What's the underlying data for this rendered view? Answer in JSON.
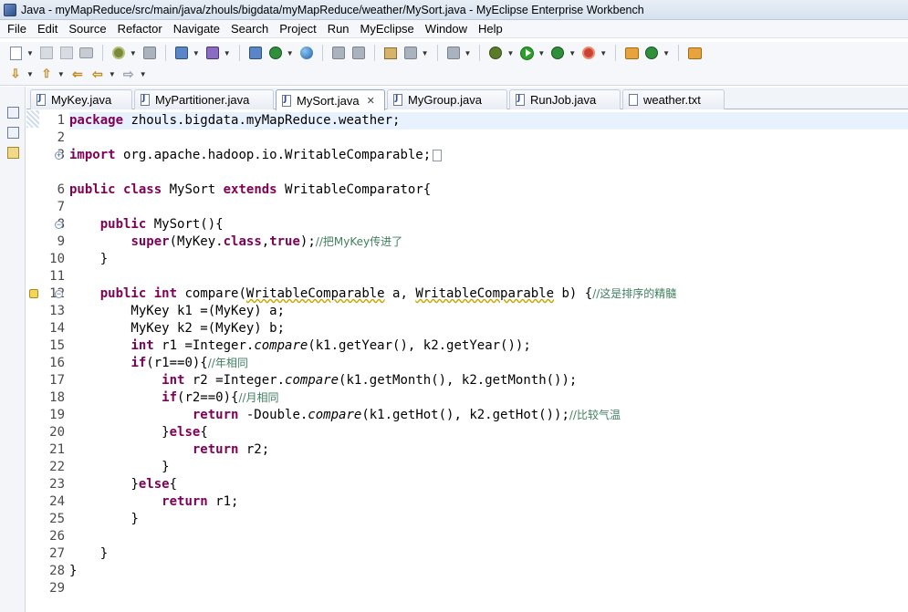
{
  "window": {
    "title": "Java - myMapReduce/src/main/java/zhouls/bigdata/myMapReduce/weather/MySort.java - MyEclipse Enterprise Workbench"
  },
  "menu": [
    {
      "label": "File"
    },
    {
      "label": "Edit"
    },
    {
      "label": "Source"
    },
    {
      "label": "Refactor"
    },
    {
      "label": "Navigate"
    },
    {
      "label": "Search"
    },
    {
      "label": "Project"
    },
    {
      "label": "Run"
    },
    {
      "label": "MyEclipse"
    },
    {
      "label": "Window"
    },
    {
      "label": "Help"
    }
  ],
  "tabs": [
    {
      "label": "MyKey.java",
      "icon": "java-file-icon",
      "active": false
    },
    {
      "label": "MyPartitioner.java",
      "icon": "java-file-icon",
      "active": false
    },
    {
      "label": "MySort.java",
      "icon": "java-file-icon",
      "active": true,
      "close": "✕"
    },
    {
      "label": "MyGroup.java",
      "icon": "java-file-icon",
      "active": false
    },
    {
      "label": "RunJob.java",
      "icon": "java-file-icon",
      "active": false
    },
    {
      "label": "weather.txt",
      "icon": "text-file-icon",
      "active": false
    }
  ],
  "editor": {
    "line_numbers": [
      "1",
      "2",
      "3",
      "6",
      "7",
      "8",
      "9",
      "10",
      "11",
      "12",
      "13",
      "14",
      "15",
      "16",
      "17",
      "18",
      "19",
      "20",
      "21",
      "22",
      "23",
      "24",
      "25",
      "26",
      "27",
      "28",
      "29"
    ],
    "lines": {
      "l1_kw": "package",
      "l1_rest": " zhouls.bigdata.myMapReduce.weather;",
      "l3_kw": "import",
      "l3_rest": " org.apache.hadoop.io.WritableComparable;",
      "l6_kw1": "public",
      "l6_kw2": "class",
      "l6_mid": " MySort ",
      "l6_kw3": "extends",
      "l6_rest": " WritableComparator{",
      "l8_kw": "public",
      "l8_rest": " MySort(){",
      "l9_kw": "super",
      "l9_a": "(MyKey.",
      "l9_kw2": "class",
      "l9_b": ",",
      "l9_kw3": "true",
      "l9_c": ");",
      "l9_cm": "//把MyKey传进了",
      "l10": "    }",
      "l12_kw1": "public",
      "l12_kw2": "int",
      "l12_a": " compare(",
      "l12_t1": "WritableComparable",
      "l12_b": " a, ",
      "l12_t2": "WritableComparable",
      "l12_c": " b) {",
      "l12_cm": "//这是排序的精髓",
      "l13": "        MyKey k1 =(MyKey) a;",
      "l14": "        MyKey k2 =(MyKey) b;",
      "l15_kw": "int",
      "l15_a": " r1 =Integer.",
      "l15_it": "compare",
      "l15_b": "(k1.getYear(), k2.getYear());",
      "l16_kw": "if",
      "l16_a": "(r1==0){",
      "l16_cm": "//年相同",
      "l17_kw": "int",
      "l17_a": " r2 =Integer.",
      "l17_it": "compare",
      "l17_b": "(k1.getMonth(), k2.getMonth());",
      "l18_kw": "if",
      "l18_a": "(r2==0){",
      "l18_cm": "//月相同",
      "l19_kw": "return",
      "l19_a": " -Double.",
      "l19_it": "compare",
      "l19_b": "(k1.getHot(), k2.getHot());",
      "l19_cm": "//比较气温",
      "l20_a": "}",
      "l20_kw": "else",
      "l20_b": "{",
      "l21_kw": "return",
      "l21_a": " r2;",
      "l22": "}",
      "l23_a": "}",
      "l23_kw": "else",
      "l23_b": "{",
      "l24_kw": "return",
      "l24_a": " r1;",
      "l25": "}",
      "l27": "}",
      "l28": "}"
    }
  },
  "colors": {
    "keyword": "#7f0055",
    "comment": "#3f7f5f",
    "current_line": "#e8f2fe"
  }
}
